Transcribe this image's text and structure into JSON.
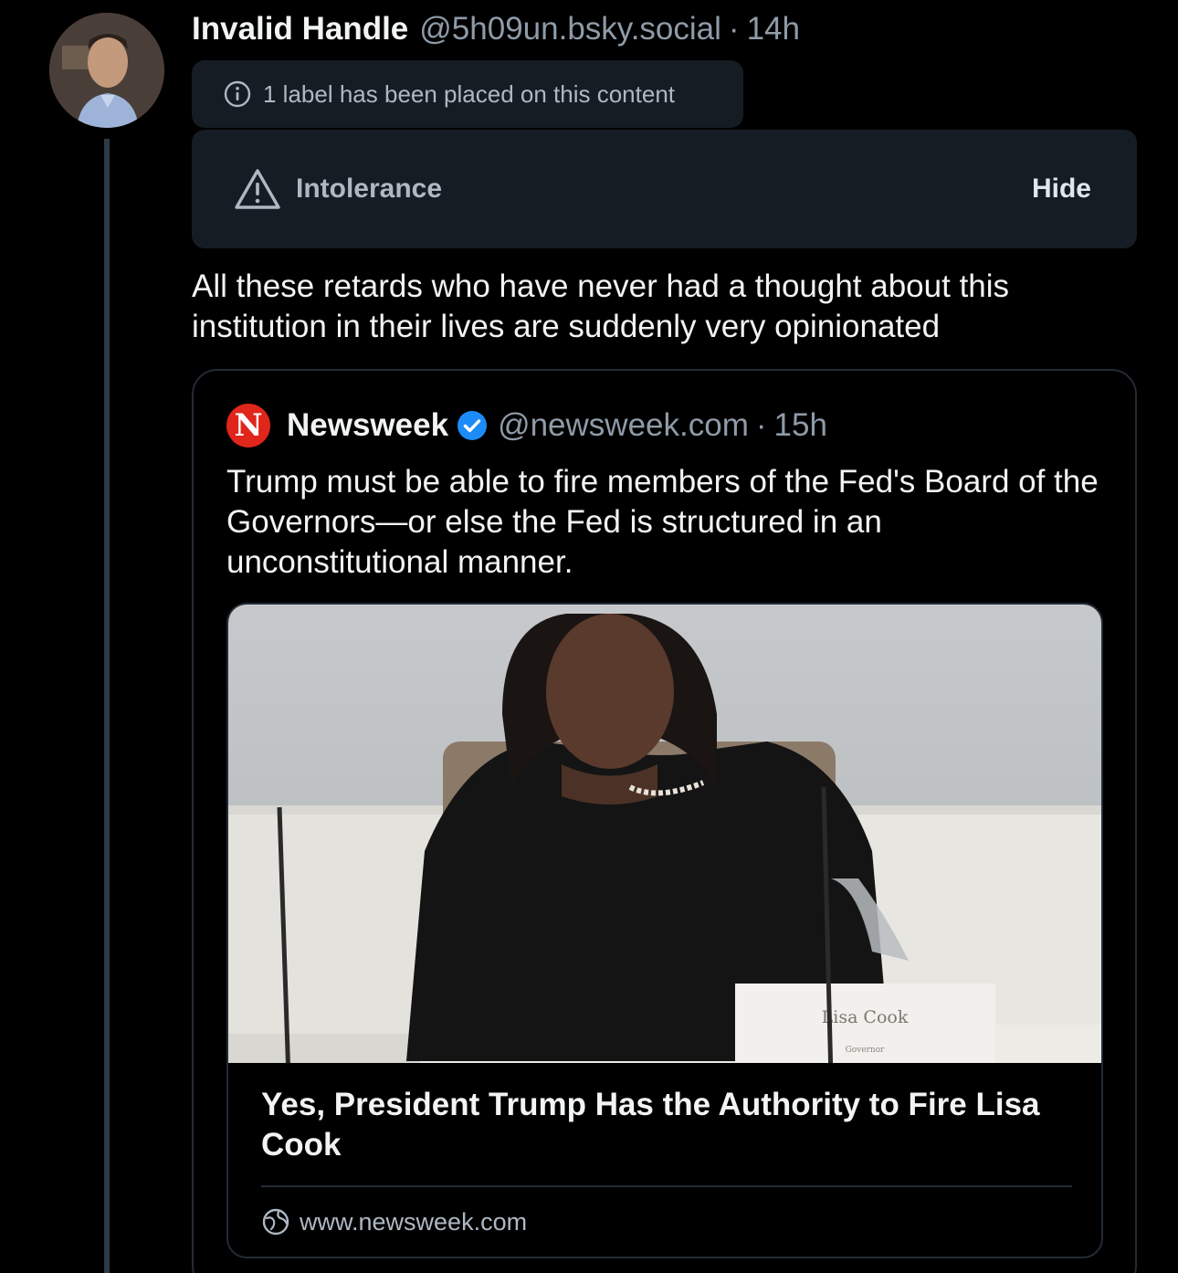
{
  "post": {
    "author_name": "Invalid Handle",
    "author_handle": "@5h09un.bsky.social",
    "separator": "·",
    "time": "14h",
    "label_notice": "1 label has been placed on this content",
    "warning_label": "Intolerance",
    "hide_label": "Hide",
    "text": "All these retards who have never had a thought about this institution in their lives are suddenly very opinionated"
  },
  "quote": {
    "logo_letter": "N",
    "name": "Newsweek",
    "handle": "@newsweek.com",
    "separator": "·",
    "time": "15h",
    "text": "Trump must be able to fire members of the Fed's Board of the Governors—or else the Fed is structured in an unconstitutional manner.",
    "link": {
      "nameplate_text": "Lisa Cook",
      "nameplate_subtext": "Governor",
      "title": "Yes, President Trump Has the Authority to Fire Lisa Cook",
      "domain": "www.newsweek.com"
    }
  },
  "colors": {
    "background": "#000000",
    "text_primary": "#f1f3f5",
    "text_secondary": "#8f9ba8",
    "panel": "#161c23",
    "border": "#232b35",
    "newsweek_red": "#e0261b",
    "verified_blue": "#1d8cf8"
  }
}
